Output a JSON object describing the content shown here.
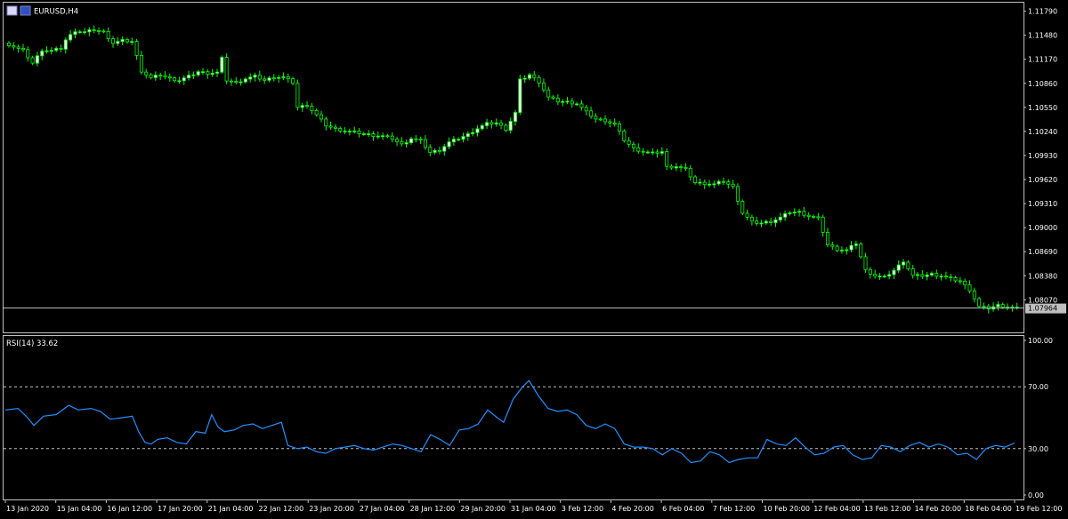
{
  "colors": {
    "background": "#000000",
    "frame": "#c0c0c0",
    "bull_candle": "#ffffff",
    "candle_outline": "#00ff00",
    "price_line": "#c0c0c0",
    "rsi_line": "#1e90ff",
    "level_line": "#c0c0c0",
    "price_tag_bg": "#c0c0c0"
  },
  "chart_data": [
    {
      "type": "candlestick",
      "title": "EURUSD,H4",
      "symbol": "EURUSD",
      "timeframe": "H4",
      "yticks": [
        "1.11790",
        "1.11480",
        "1.11170",
        "1.10860",
        "1.10550",
        "1.10240",
        "1.09930",
        "1.09620",
        "1.09310",
        "1.09000",
        "1.08690",
        "1.08380",
        "1.08070"
      ],
      "ylim": [
        1.0765,
        1.119
      ],
      "current_price": "1.07964",
      "grid": false,
      "legend": "none",
      "close_path": [
        [
          0,
          1.1136
        ],
        [
          3,
          1.1128
        ],
        [
          5,
          1.1112
        ],
        [
          7,
          1.1129
        ],
        [
          9,
          1.1128
        ],
        [
          11,
          1.1131
        ],
        [
          12,
          1.1142
        ],
        [
          14,
          1.1154
        ],
        [
          16,
          1.1152
        ],
        [
          18,
          1.1155
        ],
        [
          20,
          1.1152
        ],
        [
          22,
          1.1138
        ],
        [
          24,
          1.1141
        ],
        [
          26,
          1.114
        ],
        [
          28,
          1.1102
        ],
        [
          30,
          1.1093
        ],
        [
          32,
          1.1097
        ],
        [
          34,
          1.1092
        ],
        [
          36,
          1.109
        ],
        [
          38,
          1.1095
        ],
        [
          40,
          1.1101
        ],
        [
          42,
          1.1099
        ],
        [
          44,
          1.11
        ],
        [
          45,
          1.1118
        ],
        [
          46,
          1.109
        ],
        [
          48,
          1.1087
        ],
        [
          50,
          1.1092
        ],
        [
          52,
          1.1095
        ],
        [
          54,
          1.109
        ],
        [
          56,
          1.1094
        ],
        [
          58,
          1.1094
        ],
        [
          60,
          1.1087
        ],
        [
          61,
          1.1055
        ],
        [
          63,
          1.1058
        ],
        [
          65,
          1.1045
        ],
        [
          67,
          1.1032
        ],
        [
          69,
          1.1027
        ],
        [
          71,
          1.1025
        ],
        [
          73,
          1.1023
        ],
        [
          75,
          1.1021
        ],
        [
          77,
          1.1019
        ],
        [
          79,
          1.1018
        ],
        [
          81,
          1.1015
        ],
        [
          83,
          1.1007
        ],
        [
          85,
          1.1015
        ],
        [
          87,
          1.1012
        ],
        [
          89,
          1.0997
        ],
        [
          91,
          1.1
        ],
        [
          93,
          1.101
        ],
        [
          95,
          1.1015
        ],
        [
          97,
          1.102
        ],
        [
          99,
          1.1028
        ],
        [
          101,
          1.1034
        ],
        [
          103,
          1.1035
        ],
        [
          105,
          1.1027
        ],
        [
          107,
          1.1048
        ],
        [
          108,
          1.109
        ],
        [
          110,
          1.1097
        ],
        [
          112,
          1.1088
        ],
        [
          114,
          1.1068
        ],
        [
          116,
          1.1063
        ],
        [
          118,
          1.1062
        ],
        [
          120,
          1.106
        ],
        [
          122,
          1.1049
        ],
        [
          124,
          1.104
        ],
        [
          126,
          1.1038
        ],
        [
          128,
          1.1033
        ],
        [
          130,
          1.1013
        ],
        [
          132,
          1.1002
        ],
        [
          134,
          1.0998
        ],
        [
          136,
          1.0996
        ],
        [
          138,
          1.0998
        ],
        [
          139,
          1.0978
        ],
        [
          141,
          1.0979
        ],
        [
          143,
          1.0975
        ],
        [
          145,
          1.0958
        ],
        [
          147,
          1.0957
        ],
        [
          149,
          1.0956
        ],
        [
          151,
          1.096
        ],
        [
          153,
          1.0952
        ],
        [
          155,
          1.0919
        ],
        [
          157,
          1.0907
        ],
        [
          159,
          1.0906
        ],
        [
          161,
          1.0908
        ],
        [
          163,
          1.0913
        ],
        [
          165,
          1.092
        ],
        [
          167,
          1.092
        ],
        [
          169,
          1.0915
        ],
        [
          171,
          1.0912
        ],
        [
          173,
          1.0878
        ],
        [
          175,
          1.0872
        ],
        [
          177,
          1.0871
        ],
        [
          179,
          1.088
        ],
        [
          181,
          1.0845
        ],
        [
          183,
          1.0838
        ],
        [
          185,
          1.0836
        ],
        [
          187,
          1.0845
        ],
        [
          189,
          1.0857
        ],
        [
          191,
          1.0838
        ],
        [
          193,
          1.0838
        ],
        [
          195,
          1.084
        ],
        [
          197,
          1.0838
        ],
        [
          199,
          1.0834
        ],
        [
          201,
          1.0831
        ],
        [
          203,
          1.082
        ],
        [
          205,
          1.0798
        ],
        [
          207,
          1.0796
        ],
        [
          209,
          1.08
        ],
        [
          211,
          1.0798
        ],
        [
          213,
          1.0796
        ]
      ]
    },
    {
      "type": "line",
      "title": "RSI(14) 33.62",
      "indicator": "RSI",
      "period": 14,
      "current_value": "33.62",
      "yticks": [
        "100.00",
        "70.00",
        "30.00",
        "0.00"
      ],
      "ylim": [
        0,
        100
      ],
      "levels": [
        70,
        30
      ],
      "values_path": [
        [
          0,
          55
        ],
        [
          4,
          56
        ],
        [
          7,
          50
        ],
        [
          9,
          45
        ],
        [
          12,
          51
        ],
        [
          16,
          52
        ],
        [
          20,
          58
        ],
        [
          23,
          55
        ],
        [
          27,
          56
        ],
        [
          30,
          54
        ],
        [
          33,
          49
        ],
        [
          37,
          50
        ],
        [
          40,
          51
        ],
        [
          42,
          41
        ],
        [
          44,
          34
        ],
        [
          46,
          33
        ],
        [
          48,
          36
        ],
        [
          51,
          37
        ],
        [
          54,
          34
        ],
        [
          57,
          33
        ],
        [
          60,
          41
        ],
        [
          63,
          40
        ],
        [
          65,
          52
        ],
        [
          67,
          44
        ],
        [
          69,
          41
        ],
        [
          72,
          42
        ],
        [
          75,
          45
        ],
        [
          78,
          46
        ],
        [
          81,
          43
        ],
        [
          84,
          45
        ],
        [
          87,
          47
        ],
        [
          89,
          32
        ],
        [
          92,
          30
        ],
        [
          95,
          31
        ],
        [
          98,
          28
        ],
        [
          101,
          27
        ],
        [
          104,
          30
        ],
        [
          107,
          31
        ],
        [
          110,
          32
        ],
        [
          113,
          30
        ],
        [
          116,
          29
        ],
        [
          119,
          31
        ],
        [
          122,
          33
        ],
        [
          125,
          32
        ],
        [
          128,
          30
        ],
        [
          131,
          28
        ],
        [
          134,
          39
        ],
        [
          137,
          36
        ],
        [
          140,
          32
        ],
        [
          143,
          42
        ],
        [
          146,
          43
        ],
        [
          149,
          46
        ],
        [
          152,
          55
        ],
        [
          155,
          50
        ],
        [
          157,
          47
        ],
        [
          160,
          62
        ],
        [
          163,
          70
        ],
        [
          165,
          74
        ],
        [
          168,
          64
        ],
        [
          171,
          56
        ],
        [
          174,
          54
        ],
        [
          177,
          55
        ],
        [
          180,
          52
        ],
        [
          183,
          45
        ],
        [
          186,
          43
        ],
        [
          189,
          46
        ],
        [
          192,
          43
        ],
        [
          195,
          33
        ],
        [
          198,
          31
        ],
        [
          201,
          31
        ],
        [
          204,
          30
        ],
        [
          207,
          26
        ],
        [
          210,
          30
        ],
        [
          213,
          27
        ],
        [
          216,
          21
        ],
        [
          219,
          22
        ],
        [
          222,
          28
        ],
        [
          225,
          26
        ],
        [
          228,
          21
        ],
        [
          231,
          23
        ],
        [
          234,
          24
        ],
        [
          237,
          24
        ],
        [
          240,
          36
        ],
        [
          243,
          33
        ],
        [
          246,
          32
        ],
        [
          249,
          37
        ],
        [
          252,
          31
        ],
        [
          255,
          26
        ],
        [
          258,
          27
        ],
        [
          261,
          31
        ],
        [
          264,
          32
        ],
        [
          267,
          26
        ],
        [
          270,
          23
        ],
        [
          273,
          24
        ],
        [
          276,
          32
        ],
        [
          279,
          31
        ],
        [
          282,
          28
        ],
        [
          285,
          32
        ],
        [
          288,
          34
        ],
        [
          291,
          31
        ],
        [
          294,
          33
        ],
        [
          297,
          31
        ],
        [
          300,
          26
        ],
        [
          303,
          27
        ],
        [
          306,
          23
        ],
        [
          309,
          30
        ],
        [
          312,
          32
        ],
        [
          315,
          31
        ],
        [
          318,
          33.62
        ]
      ]
    }
  ],
  "xaxis": {
    "ticks": [
      "13 Jan 2020",
      "15 Jan 04:00",
      "16 Jan 12:00",
      "17 Jan 20:00",
      "21 Jan 04:00",
      "22 Jan 12:00",
      "23 Jan 20:00",
      "27 Jan 04:00",
      "28 Jan 12:00",
      "29 Jan 20:00",
      "31 Jan 04:00",
      "3 Feb 12:00",
      "4 Feb 20:00",
      "6 Feb 04:00",
      "7 Feb 12:00",
      "10 Feb 20:00",
      "12 Feb 04:00",
      "13 Feb 12:00",
      "14 Feb 20:00",
      "18 Feb 04:00",
      "19 Feb 12:00"
    ]
  }
}
